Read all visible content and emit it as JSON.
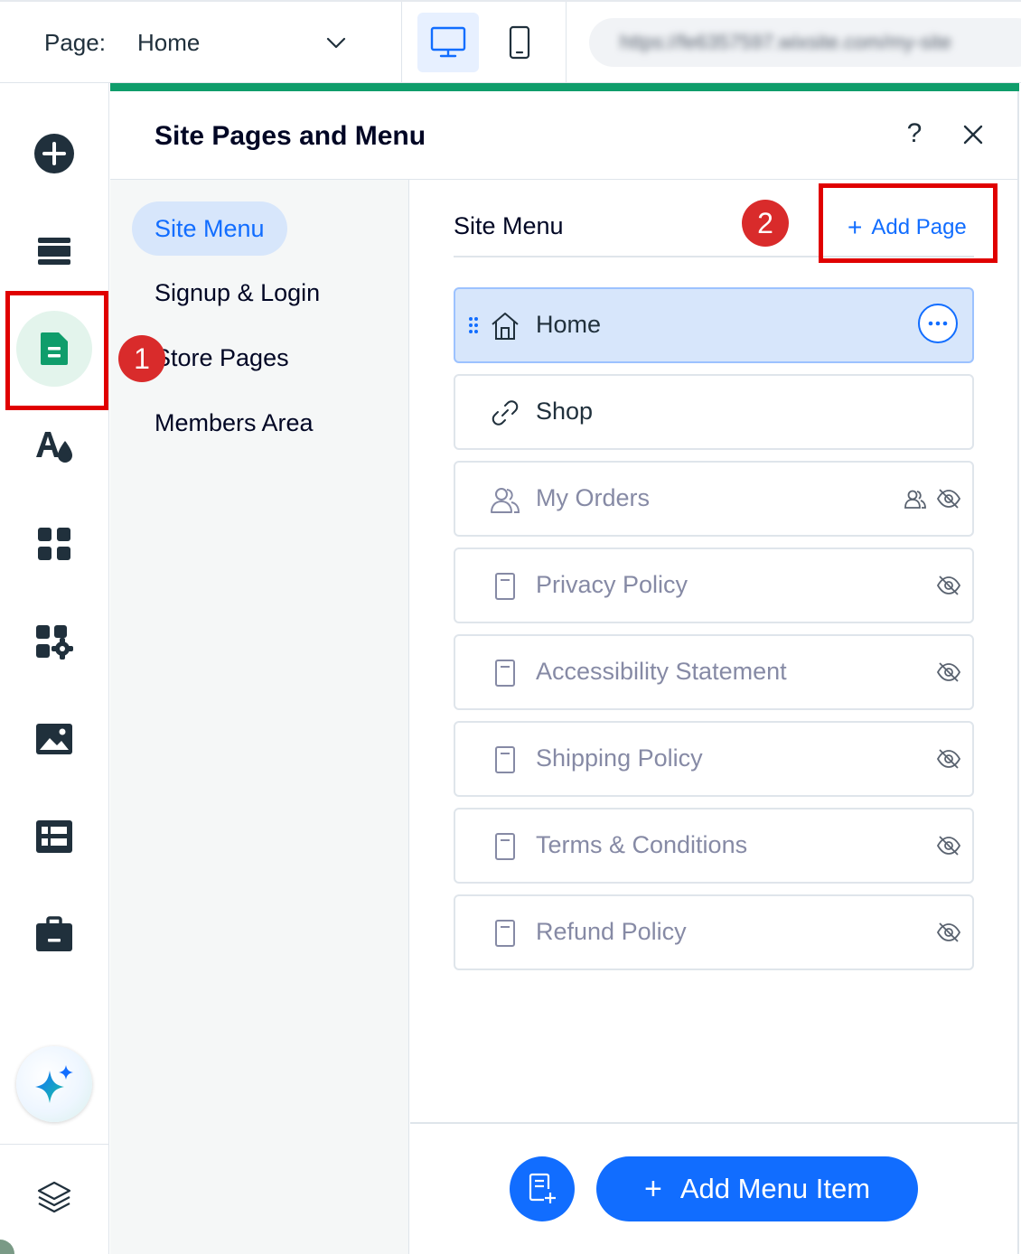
{
  "topbar": {
    "page_label": "Page:",
    "page_value": "Home",
    "url_text": "https://fe6357597.wixsite.com/my-site"
  },
  "rail": {
    "items": [
      "add-elements",
      "sections",
      "pages",
      "site-design",
      "apps",
      "add-apps",
      "media",
      "cms",
      "business"
    ],
    "active": "pages"
  },
  "panel": {
    "title": "Site Pages and Menu",
    "help_label": "?",
    "categories": [
      {
        "label": "Site Menu",
        "active": true
      },
      {
        "label": "Signup & Login",
        "active": false
      },
      {
        "label": "Store Pages",
        "active": false
      },
      {
        "label": "Members Area",
        "active": false
      }
    ],
    "list_title": "Site Menu",
    "add_page_label": "Add Page",
    "pages": [
      {
        "label": "Home",
        "icon": "home-icon",
        "selected": true,
        "hidden": false,
        "members_only": false
      },
      {
        "label": "Shop",
        "icon": "link-icon",
        "selected": false,
        "hidden": false,
        "members_only": false
      },
      {
        "label": "My Orders",
        "icon": "members-icon",
        "selected": false,
        "hidden": true,
        "members_only": true
      },
      {
        "label": "Privacy Policy",
        "icon": "page-icon",
        "selected": false,
        "hidden": true,
        "members_only": false
      },
      {
        "label": "Accessibility Statement",
        "icon": "page-icon",
        "selected": false,
        "hidden": true,
        "members_only": false
      },
      {
        "label": "Shipping Policy",
        "icon": "page-icon",
        "selected": false,
        "hidden": true,
        "members_only": false
      },
      {
        "label": "Terms & Conditions",
        "icon": "page-icon",
        "selected": false,
        "hidden": true,
        "members_only": false
      },
      {
        "label": "Refund Policy",
        "icon": "page-icon",
        "selected": false,
        "hidden": true,
        "members_only": false
      }
    ],
    "add_menu_item_label": "Add Menu Item"
  },
  "annotations": {
    "badge_1": "1",
    "badge_2": "2"
  },
  "colors": {
    "accent_blue": "#116dff",
    "accent_green": "#0f9d6b",
    "annotation_red": "#e00000"
  }
}
